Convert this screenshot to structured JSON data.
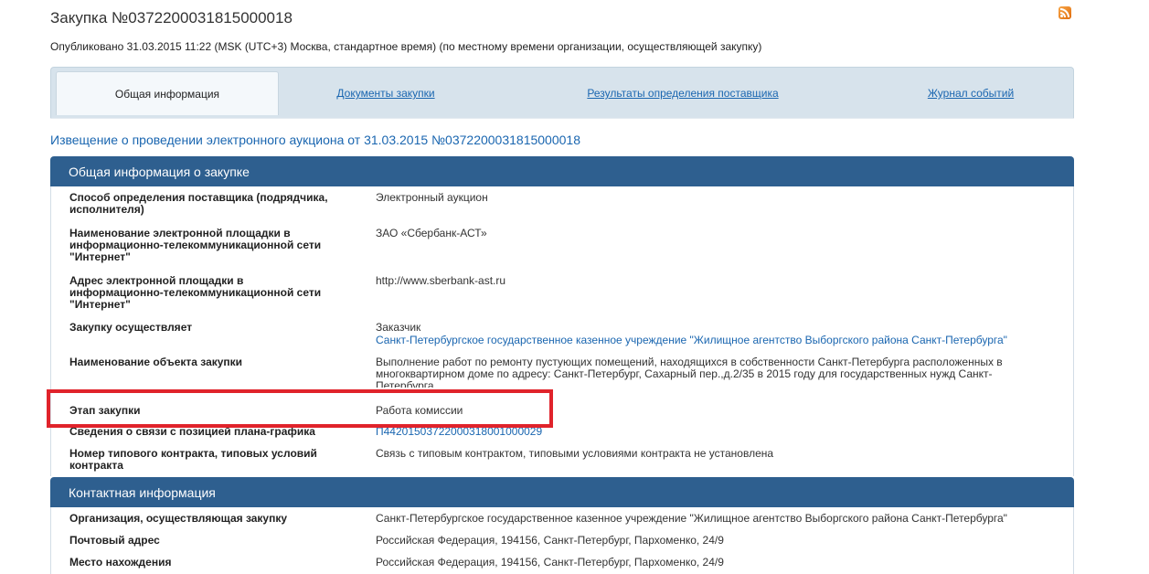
{
  "header": {
    "title": "Закупка №0372200031815000018",
    "published": "Опубликовано 31.03.2015 11:22 (MSK (UTC+3) Москва, стандартное время) (по местному времени организации, осуществляющей закупку)"
  },
  "tabs": [
    {
      "label": "Общая информация",
      "active": true
    },
    {
      "label": "Документы закупки",
      "active": false
    },
    {
      "label": "Результаты определения поставщика",
      "active": false
    },
    {
      "label": "Журнал событий",
      "active": false
    }
  ],
  "notice_title": "Извещение о проведении электронного аукциона от 31.03.2015 №0372200031815000018",
  "section_general": {
    "title": "Общая информация о закупке",
    "rows": [
      {
        "label": "Способ определения поставщика (подрядчика, исполнителя)",
        "value": "Электронный аукцион"
      },
      {
        "label": "Наименование электронной площадки в информационно-телекоммуникационной сети \"Интернет\"",
        "value": "ЗАО «Сбербанк-АСТ»"
      },
      {
        "label": "Адрес электронной площадки в информационно-телекоммуникационной сети \"Интернет\"",
        "value": "http://www.sberbank-ast.ru"
      },
      {
        "label": "Закупку осуществляет",
        "value": "Заказчик",
        "value_link": "Санкт-Петербургское государственное казенное учреждение \"Жилищное агентство Выборгского района Санкт-Петербурга\""
      },
      {
        "label": "Наименование объекта закупки",
        "value": "Выполнение работ по ремонту пустующих помещений, находящихся в собственности Санкт-Петербурга расположенных в многоквартирном доме по адресу: Санкт-Петербург, Сахарный пер.,д.2/35 в 2015 году для государственных нужд Санкт-Петербурга"
      },
      {
        "label": "Этап закупки",
        "value": "Работа комиссии"
      },
      {
        "label": "Сведения о связи с позицией плана-графика",
        "value": "П44201503722000318001000029"
      },
      {
        "label": "Номер типового контракта, типовых условий контракта",
        "value": "Связь с типовым контрактом, типовыми условиями контракта не установлена"
      }
    ]
  },
  "section_contact": {
    "title": "Контактная информация",
    "rows": [
      {
        "label": "Организация, осуществляющая закупку",
        "value": "Санкт-Петербургское государственное казенное учреждение \"Жилищное агентство Выборгского района Санкт-Петербурга\""
      },
      {
        "label": "Почтовый адрес",
        "value": "Российская Федерация, 194156, Санкт-Петербург, Пархоменко, 24/9"
      },
      {
        "label": "Место нахождения",
        "value": "Российская Федерация, 194156, Санкт-Петербург, Пархоменко, 24/9"
      }
    ]
  },
  "colors": {
    "accent": "#2e5f8f",
    "link": "#1a66b0",
    "highlight": "#e0232b"
  },
  "icons": {
    "feed": "rss-icon"
  }
}
